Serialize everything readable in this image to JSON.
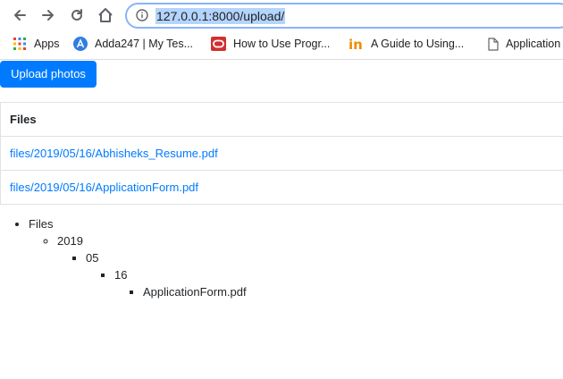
{
  "browser": {
    "url": "127.0.0.1:8000/upload/",
    "bookmarks": [
      {
        "label": "Apps",
        "icon": "apps-grid-icon"
      },
      {
        "label": "Adda247 | My Tes...",
        "icon": "adda247-icon"
      },
      {
        "label": "How to Use Progr...",
        "icon": "oracle-icon"
      },
      {
        "label": "A Guide to Using...",
        "icon": "in-icon"
      },
      {
        "label": "Application",
        "icon": "document-icon"
      }
    ]
  },
  "page": {
    "upload_button_label": "Upload photos",
    "table": {
      "header": "Files",
      "rows": [
        "files/2019/05/16/Abhisheks_Resume.pdf",
        "files/2019/05/16/ApplicationForm.pdf"
      ]
    },
    "tree": {
      "root": "Files",
      "year": "2019",
      "month": "05",
      "day": "16",
      "file": "ApplicationForm.pdf"
    }
  },
  "colors": {
    "accent": "#007bff",
    "url_selection": "#b3d4fc",
    "omnibox_focus": "#8ab4f8"
  }
}
